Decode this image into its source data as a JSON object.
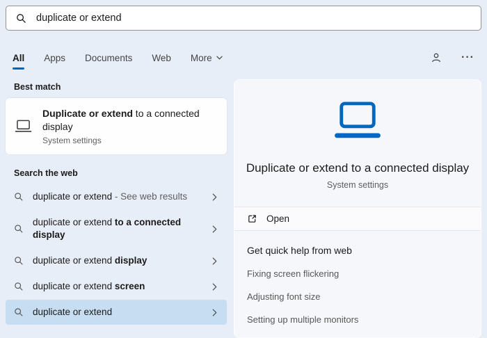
{
  "colors": {
    "accent": "#0067c0",
    "background": "#e8eef7",
    "selection_highlight": "#c7ddf1"
  },
  "search": {
    "value": "duplicate or extend"
  },
  "tabs": {
    "items": [
      {
        "label": "All"
      },
      {
        "label": "Apps"
      },
      {
        "label": "Documents"
      },
      {
        "label": "Web"
      },
      {
        "label": "More"
      }
    ],
    "active": "All",
    "options_glyph": "···"
  },
  "left": {
    "best_match_header": "Best match",
    "best_match": {
      "title_bold": "Duplicate or extend",
      "title_rest": " to a connected display",
      "subtitle": "System settings"
    },
    "web_header": "Search the web",
    "suggestions": [
      {
        "query": "duplicate or extend",
        "bold": "",
        "suffix": " - See web results"
      },
      {
        "query": "duplicate or extend ",
        "bold": "to a connected display",
        "suffix": ""
      },
      {
        "query": "duplicate or extend ",
        "bold": "display",
        "suffix": ""
      },
      {
        "query": "duplicate or extend ",
        "bold": "screen",
        "suffix": ""
      },
      {
        "query": "duplicate or extend",
        "bold": "",
        "suffix": ""
      }
    ]
  },
  "preview": {
    "title": "Duplicate or extend to a connected display",
    "subtitle": "System settings",
    "open_label": "Open",
    "help_header": "Get quick help from web",
    "help_links": [
      "Fixing screen flickering",
      "Adjusting font size",
      "Setting up multiple monitors"
    ]
  }
}
